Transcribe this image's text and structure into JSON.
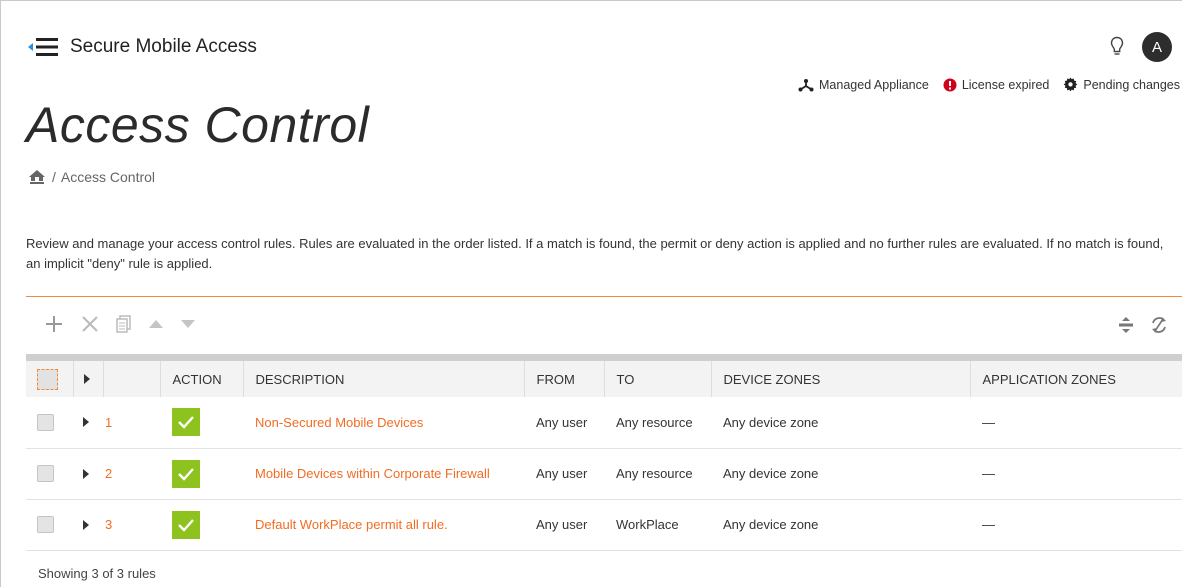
{
  "app": {
    "title": "Secure Mobile Access",
    "avatar_initial": "A"
  },
  "status": {
    "managed": "Managed Appliance",
    "license": "License expired",
    "pending": "Pending changes"
  },
  "page": {
    "title": "Access Control",
    "breadcrumb_current": "Access Control",
    "breadcrumb_separator": "/",
    "description": "Review and manage your access control rules. Rules are evaluated in the order listed. If a match is found, the permit or deny action is applied and no further rules are evaluated. If no match is found, an implicit \"deny\" rule is applied."
  },
  "colors": {
    "accent": "#f26c22",
    "permit": "#8dc21f",
    "error": "#d0021b"
  },
  "table": {
    "headers": {
      "action": "ACTION",
      "description": "DESCRIPTION",
      "from": "FROM",
      "to": "TO",
      "device_zones": "DEVICE ZONES",
      "application_zones": "APPLICATION ZONES"
    },
    "rows": [
      {
        "num": "1",
        "description": "Non-Secured Mobile Devices",
        "from": "Any user",
        "to": "Any resource",
        "device_zones": "Any device zone",
        "application_zones": "—",
        "action": "permit"
      },
      {
        "num": "2",
        "description": "Mobile Devices within Corporate Firewall",
        "from": "Any user",
        "to": "Any resource",
        "device_zones": "Any device zone",
        "application_zones": "—",
        "action": "permit"
      },
      {
        "num": "3",
        "description": "Default WorkPlace permit all rule.",
        "from": "Any user",
        "to": "WorkPlace",
        "device_zones": "Any device zone",
        "application_zones": "—",
        "action": "permit"
      }
    ],
    "footer": "Showing 3 of 3 rules"
  }
}
